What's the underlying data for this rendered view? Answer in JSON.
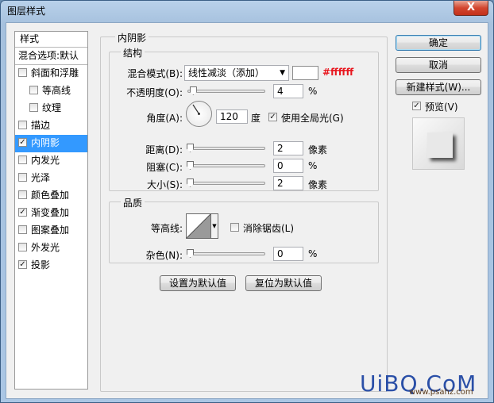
{
  "window": {
    "title": "图层样式",
    "close": "X"
  },
  "styles_list": {
    "header": "样式",
    "blend_options": "混合选项:默认",
    "items": [
      {
        "label": "斜面和浮雕",
        "checked": false,
        "sub": false
      },
      {
        "label": "等高线",
        "checked": false,
        "sub": true
      },
      {
        "label": "纹理",
        "checked": false,
        "sub": true
      },
      {
        "label": "描边",
        "checked": false,
        "sub": false
      },
      {
        "label": "内阴影",
        "checked": true,
        "sub": false,
        "selected": true
      },
      {
        "label": "内发光",
        "checked": false,
        "sub": false
      },
      {
        "label": "光泽",
        "checked": false,
        "sub": false
      },
      {
        "label": "颜色叠加",
        "checked": false,
        "sub": false
      },
      {
        "label": "渐变叠加",
        "checked": true,
        "sub": false
      },
      {
        "label": "图案叠加",
        "checked": false,
        "sub": false
      },
      {
        "label": "外发光",
        "checked": false,
        "sub": false
      },
      {
        "label": "投影",
        "checked": true,
        "sub": false
      }
    ]
  },
  "panel": {
    "title": "内阴影",
    "structure": {
      "title": "结构",
      "blend_mode_label": "混合模式(B):",
      "blend_mode_value": "线性减淡（添加）",
      "color_hex": "#ffffff",
      "opacity_label": "不透明度(O):",
      "opacity_value": "4",
      "opacity_unit": "%",
      "opacity_level": 0.04,
      "angle_label": "角度(A):",
      "angle_value": "120",
      "angle_unit": "度",
      "global_light_label": "使用全局光(G)",
      "global_light_checked": true,
      "distance_label": "距离(D):",
      "distance_value": "2",
      "distance_unit": "像素",
      "choke_label": "阻塞(C):",
      "choke_value": "0",
      "choke_unit": "%",
      "size_label": "大小(S):",
      "size_value": "2",
      "size_unit": "像素"
    },
    "quality": {
      "title": "品质",
      "contour_label": "等高线:",
      "antialias_label": "消除锯齿(L)",
      "antialias_checked": false,
      "noise_label": "杂色(N):",
      "noise_value": "0",
      "noise_unit": "%"
    },
    "make_default": "设置为默认值",
    "reset_default": "复位为默认值"
  },
  "buttons": {
    "ok": "确定",
    "cancel": "取消",
    "new_style": "新建样式(W)...",
    "preview_label": "预览(V)",
    "preview_checked": true
  },
  "watermark": {
    "main": "UiBQ.CoM",
    "sub": "www.psahz.com"
  }
}
